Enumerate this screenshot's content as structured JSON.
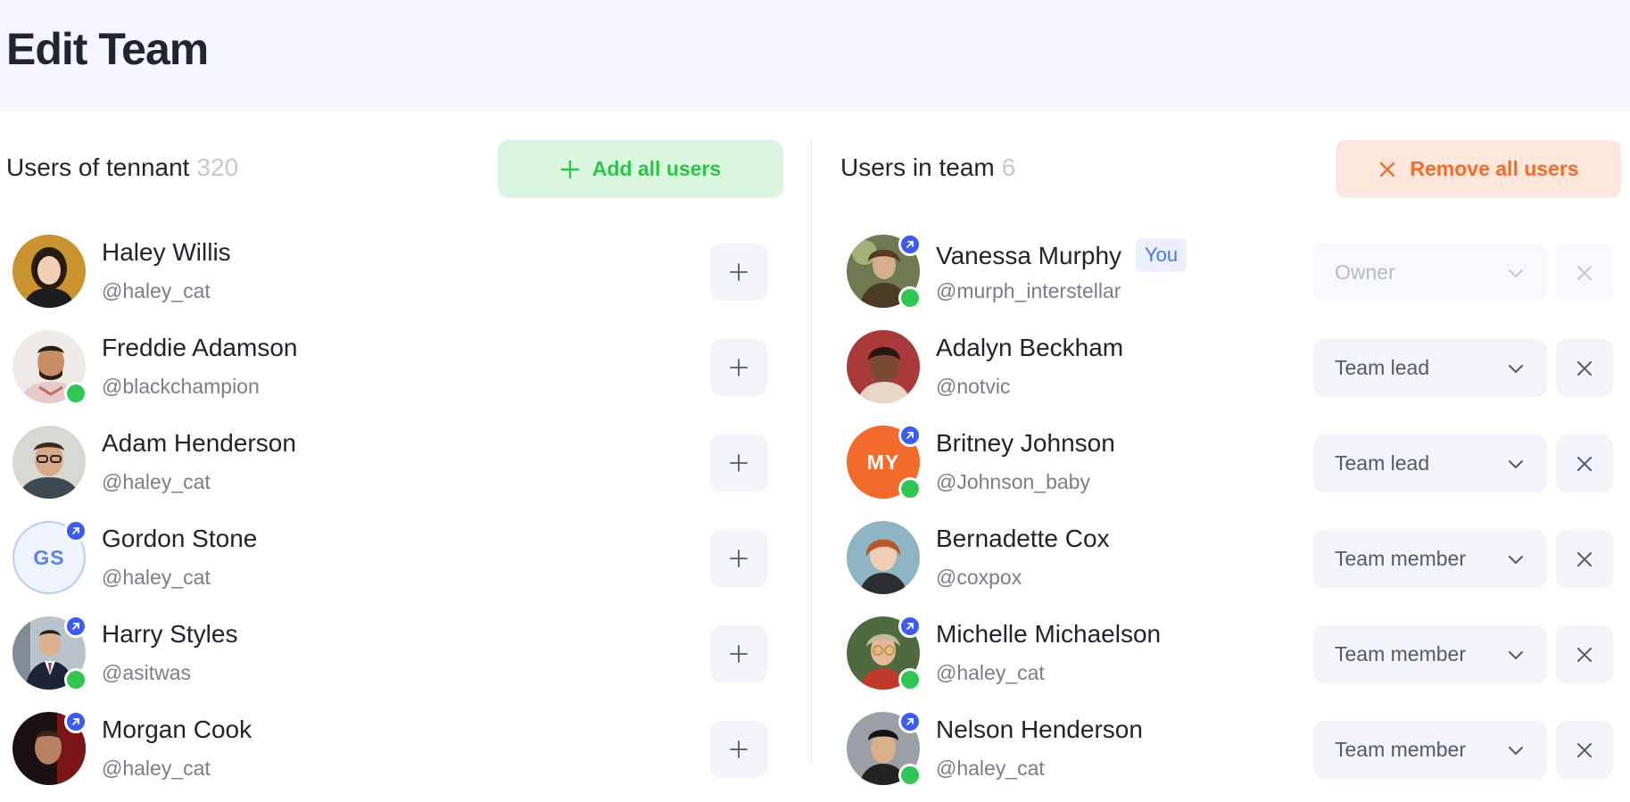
{
  "page": {
    "title": "Edit Team"
  },
  "left": {
    "title": "Users of tennant",
    "count": "320",
    "add_all_label": "Add all users",
    "users": [
      {
        "name": "Haley Willis",
        "handle": "@haley_cat",
        "avatar": "photo",
        "admin": false,
        "online": false
      },
      {
        "name": "Freddie Adamson",
        "handle": "@blackchampion",
        "avatar": "photo",
        "admin": false,
        "online": true
      },
      {
        "name": "Adam Henderson",
        "handle": "@haley_cat",
        "avatar": "photo",
        "admin": false,
        "online": false
      },
      {
        "name": "Gordon Stone",
        "handle": "@haley_cat",
        "avatar": "initials",
        "initials": "GS",
        "admin": true,
        "online": false
      },
      {
        "name": "Harry Styles",
        "handle": "@asitwas",
        "avatar": "photo",
        "admin": true,
        "online": true
      },
      {
        "name": "Morgan Cook",
        "handle": "@haley_cat",
        "avatar": "photo",
        "admin": true,
        "online": false
      }
    ]
  },
  "right": {
    "title": "Users in team",
    "count": "6",
    "remove_all_label": "Remove all users",
    "you_label": "You",
    "users": [
      {
        "name": "Vanessa Murphy",
        "handle": "@murph_interstellar",
        "role": "Owner",
        "you": true,
        "disabled": true,
        "avatar": "photo",
        "admin": true,
        "online": true
      },
      {
        "name": "Adalyn Beckham",
        "handle": "@notvic",
        "role": "Team lead",
        "avatar": "photo",
        "admin": false,
        "online": false
      },
      {
        "name": "Britney Johnson",
        "handle": "@Johnson_baby",
        "role": "Team lead",
        "avatar": "initials",
        "initials": "MY",
        "admin": true,
        "online": true
      },
      {
        "name": "Bernadette Cox",
        "handle": "@coxpox",
        "role": "Team member",
        "avatar": "photo",
        "admin": false,
        "online": false
      },
      {
        "name": "Michelle Michaelson",
        "handle": "@haley_cat",
        "role": "Team member",
        "avatar": "photo",
        "admin": true,
        "online": true
      },
      {
        "name": "Nelson Henderson",
        "handle": "@haley_cat",
        "role": "Team member",
        "avatar": "photo",
        "admin": true,
        "online": true
      }
    ]
  },
  "colors": {
    "accent_green": "#2ec44a",
    "accent_orange": "#f26c2e",
    "admin_badge": "#3b5bf2",
    "online_badge": "#2fc653",
    "you_tag": "#4a73f3"
  },
  "icons": {
    "add": "plus-icon",
    "remove": "close-icon",
    "dropdown": "chevron-down-icon",
    "admin": "admin-badge-icon"
  }
}
